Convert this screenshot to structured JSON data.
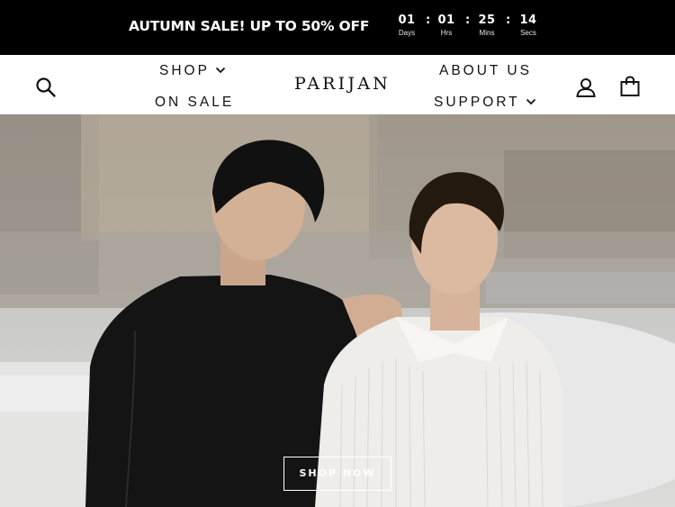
{
  "announcement": {
    "text": "AUTUMN SALE! UP TO 50% OFF",
    "countdown": [
      {
        "value": "01",
        "label": "Days"
      },
      {
        "value": "01",
        "label": "Hrs"
      },
      {
        "value": "25",
        "label": "Mins"
      },
      {
        "value": "14",
        "label": "Secs"
      }
    ],
    "separator": ":"
  },
  "header": {
    "logo": "PARIJAN",
    "nav": {
      "shop": "SHOP",
      "on_sale": "ON SALE",
      "about_us": "ABOUT US",
      "support": "SUPPORT"
    },
    "icons": [
      "search-icon",
      "account-icon",
      "cart-icon",
      "chevron-down-icon"
    ]
  },
  "hero": {
    "cta_label": "SHOP NOW"
  },
  "colors": {
    "announcement_bg": "#000000",
    "text_dark": "#111111",
    "header_bg": "#ffffff"
  }
}
